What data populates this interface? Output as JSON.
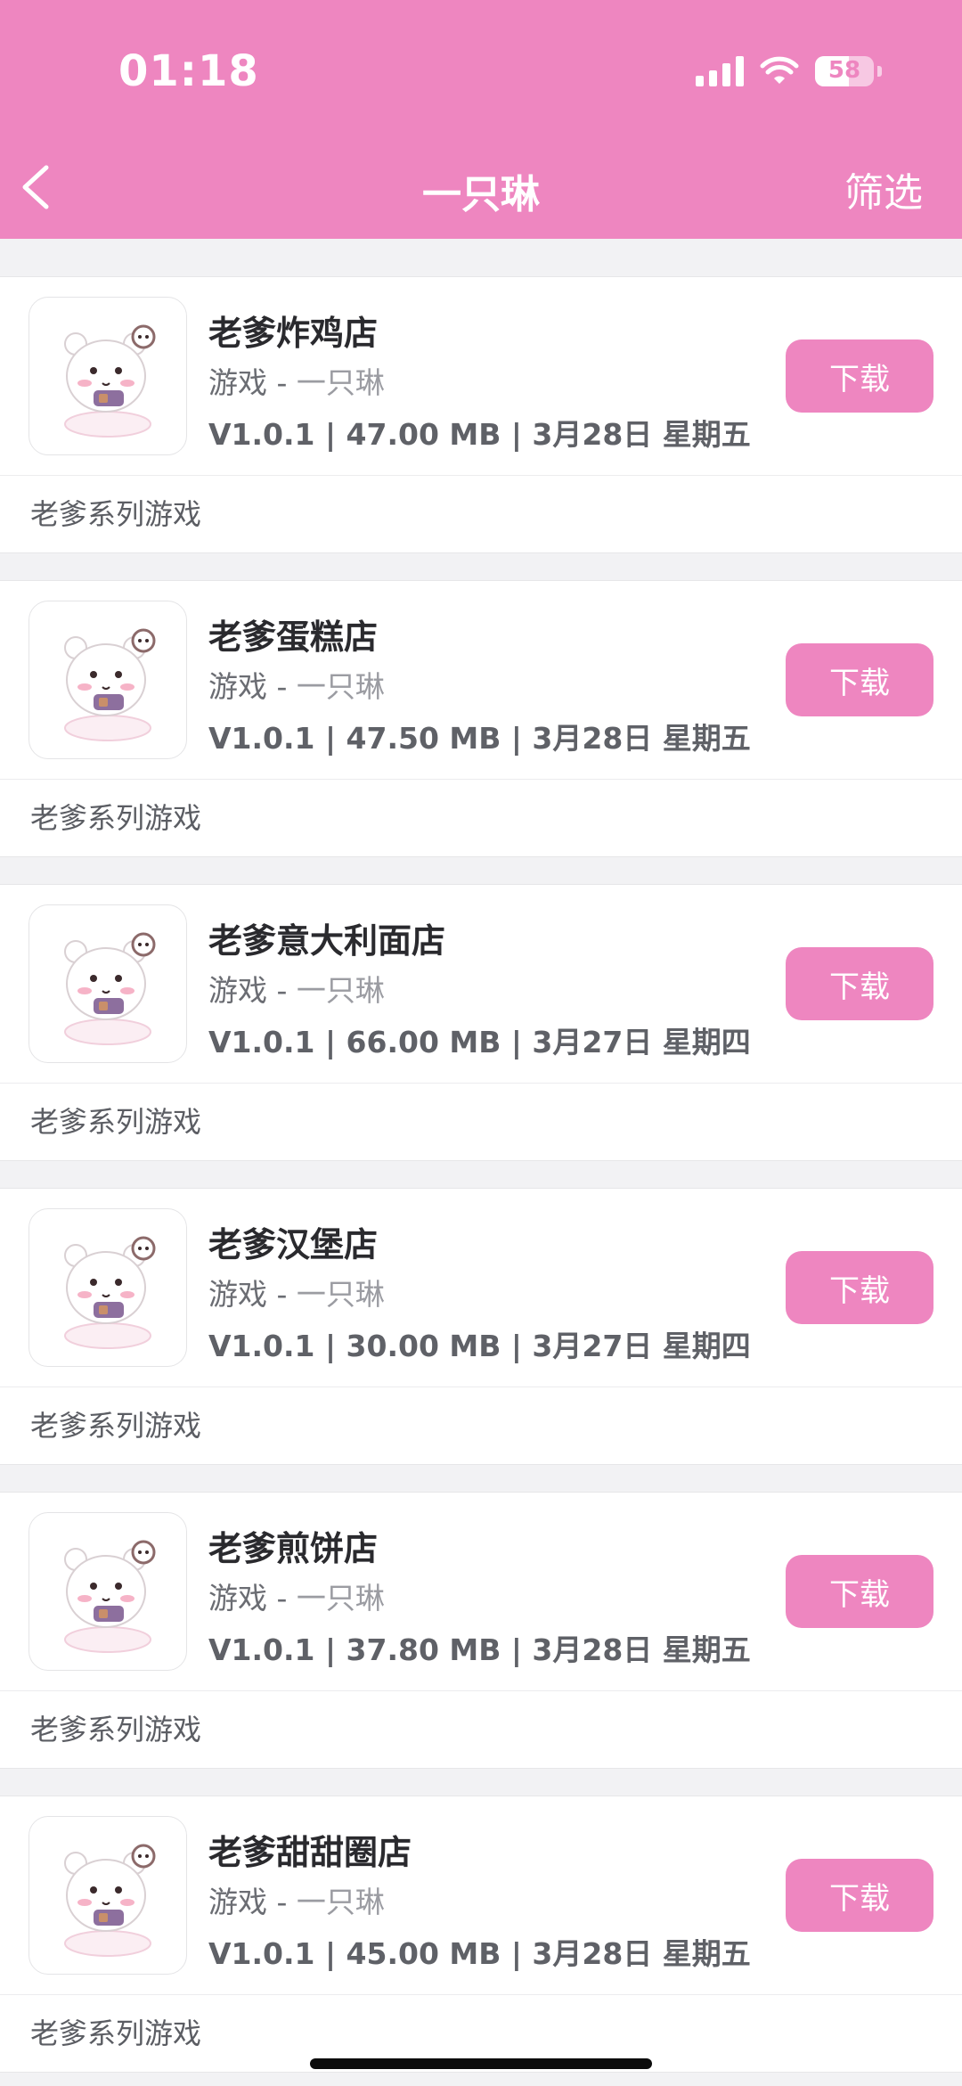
{
  "status_bar": {
    "time": "01:18",
    "battery": "58",
    "battery_level": 0.58
  },
  "header": {
    "title": "一只琳",
    "filter_label": "筛选",
    "background": "#ee86c0"
  },
  "apps": [
    {
      "name": "老爹炸鸡店",
      "category": "游戏",
      "separator": " - ",
      "developer": "一只琳",
      "meta": "V1.0.1 | 47.00 MB | 3月28日 星期五",
      "button": "下载",
      "description": "老爹系列游戏"
    },
    {
      "name": "老爹蛋糕店",
      "category": "游戏",
      "separator": " - ",
      "developer": "一只琳",
      "meta": "V1.0.1 | 47.50 MB | 3月28日 星期五",
      "button": "下载",
      "description": "老爹系列游戏"
    },
    {
      "name": "老爹意大利面店",
      "category": "游戏",
      "separator": " - ",
      "developer": "一只琳",
      "meta": "V1.0.1 | 66.00 MB | 3月27日 星期四",
      "button": "下载",
      "description": "老爹系列游戏"
    },
    {
      "name": "老爹汉堡店",
      "category": "游戏",
      "separator": " - ",
      "developer": "一只琳",
      "meta": "V1.0.1 | 30.00 MB | 3月27日 星期四",
      "button": "下载",
      "description": "老爹系列游戏"
    },
    {
      "name": "老爹煎饼店",
      "category": "游戏",
      "separator": " - ",
      "developer": "一只琳",
      "meta": "V1.0.1 | 37.80 MB | 3月28日 星期五",
      "button": "下载",
      "description": "老爹系列游戏"
    },
    {
      "name": "老爹甜甜圈店",
      "category": "游戏",
      "separator": " - ",
      "developer": "一只琳",
      "meta": "V1.0.1 | 45.00 MB | 3月28日 星期五",
      "button": "下载",
      "description": "老爹系列游戏"
    }
  ]
}
